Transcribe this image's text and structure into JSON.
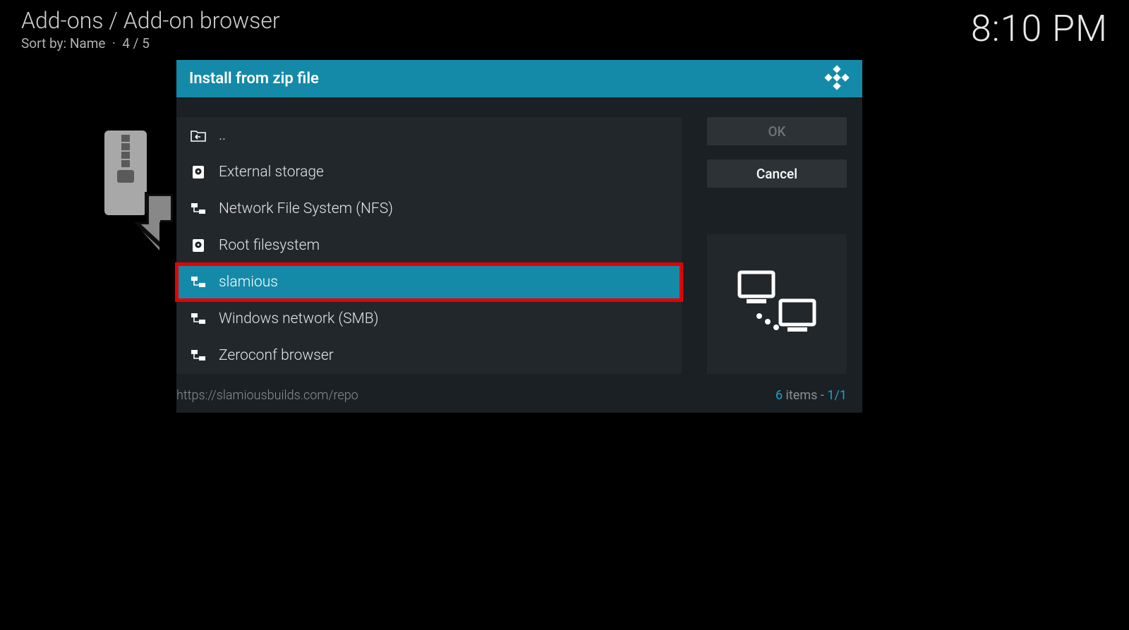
{
  "header": {
    "breadcrumb": "Add-ons / Add-on browser",
    "sort_label": "Sort by: Name",
    "position": "4 / 5",
    "clock": "8:10 PM"
  },
  "dialog": {
    "title": "Install from zip file",
    "items": [
      {
        "icon": "folder-back-icon",
        "label": ".."
      },
      {
        "icon": "disk-icon",
        "label": "External storage"
      },
      {
        "icon": "network-icon",
        "label": "Network File System (NFS)"
      },
      {
        "icon": "disk-icon",
        "label": "Root filesystem"
      },
      {
        "icon": "network-icon",
        "label": "slamious",
        "selected": true,
        "highlighted": true
      },
      {
        "icon": "network-icon",
        "label": "Windows network (SMB)"
      },
      {
        "icon": "network-icon",
        "label": "Zeroconf browser"
      }
    ],
    "buttons": {
      "ok": "OK",
      "cancel": "Cancel"
    },
    "footer": {
      "path": "https://slamiousbuilds.com/repo",
      "count": "6",
      "items_word": "items",
      "page": "1/1"
    }
  }
}
